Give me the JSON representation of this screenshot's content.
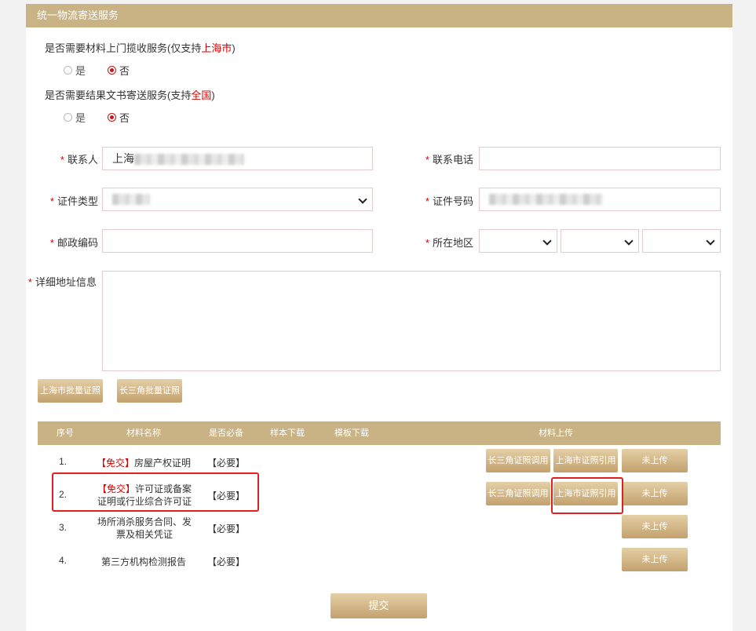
{
  "section": {
    "title": "统一物流寄送服务"
  },
  "pickup": {
    "question_prefix": "是否需要材料上门揽收服务(仅支持",
    "question_highlight": "上海市",
    "question_suffix": ")",
    "options": [
      "是",
      "否"
    ],
    "selected": "否"
  },
  "delivery": {
    "question_prefix": "是否需要结果文书寄送服务(支持",
    "question_highlight": "全国",
    "question_suffix": ")",
    "options": [
      "是",
      "否"
    ],
    "selected": "否"
  },
  "form": {
    "required_mark": "*",
    "contact_label": "联系人",
    "contact_value": "上海",
    "phone_label": "联系电话",
    "phone_value": "",
    "idtype_label": "证件类型",
    "idnum_label": "证件号码",
    "postal_label": "邮政编码",
    "postal_value": "",
    "region_label": "所在地区",
    "address_label": "详细地址信息",
    "address_value": ""
  },
  "bulk_buttons": {
    "shanghai": "上海市批量证照",
    "yrd": "长三角批量证照"
  },
  "table": {
    "headers": [
      "序号",
      "材料名称",
      "是否必备",
      "样本下载",
      "模板下载",
      "材料上传"
    ],
    "rows": [
      {
        "no": "1.",
        "free": "【免交】",
        "name": "房屋产权证明",
        "required": "【必要】",
        "yrd_btn": "长三角证照调用",
        "sh_btn": "上海市证照引用",
        "upload": "未上传"
      },
      {
        "no": "2.",
        "free": "【免交】",
        "name_line1": "许可证或备案",
        "name_line2": "证明或行业综合许可证",
        "required": "【必要】",
        "yrd_btn": "长三角证照调用",
        "sh_btn": "上海市证照引用",
        "upload": "未上传"
      },
      {
        "no": "3.",
        "name_line1": "场所消杀服务合同、发",
        "name_line2": "票及相关凭证",
        "required": "【必要】",
        "upload": "未上传"
      },
      {
        "no": "4.",
        "name": "第三方机构检测报告",
        "required": "【必要】",
        "upload": "未上传"
      }
    ]
  },
  "submit_label": "提交",
  "colors": {
    "header_bg": "#c9b284",
    "required": "#d40000",
    "highlight_box": "#e02020"
  }
}
